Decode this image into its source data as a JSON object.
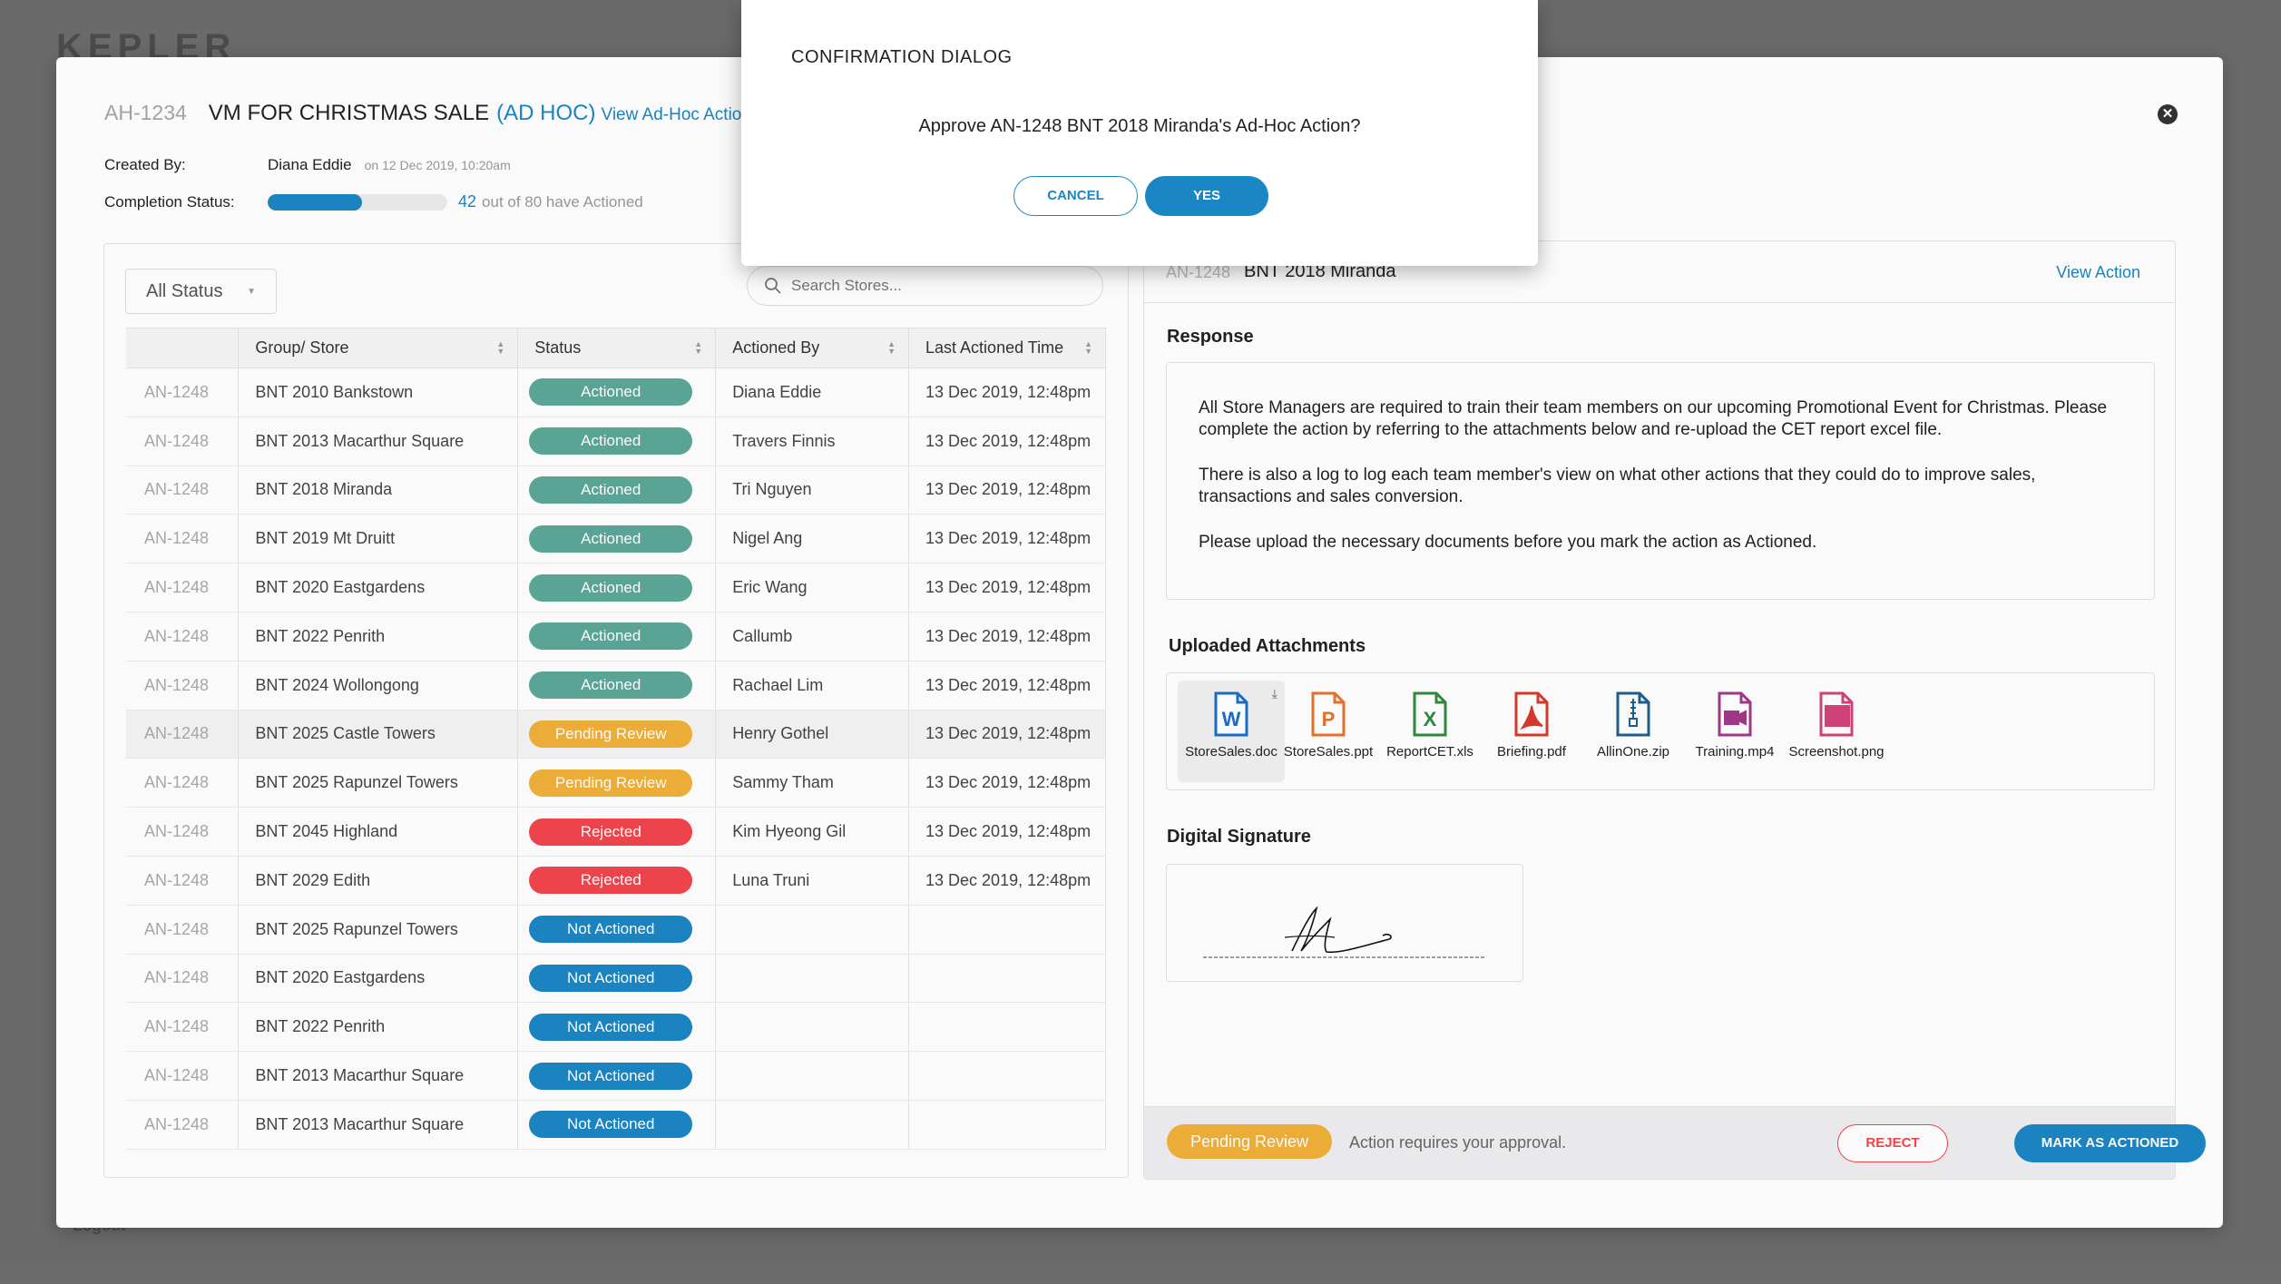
{
  "backdrop": {
    "logo": "KEPLER",
    "logout": "Logout"
  },
  "header": {
    "code": "AH-1234",
    "title": "VM FOR CHRISTMAS SALE",
    "tag": "(AD HOC)",
    "view_link": "View Ad-Hoc Action D"
  },
  "meta": {
    "created_by_label": "Created By:",
    "created_by": "Diana Eddie",
    "created_on": "on 12 Dec 2019, 10:20am",
    "completion_label": "Completion Status:",
    "completed_count": "42",
    "completed_rest": "out of 80 have Actioned",
    "progress_fraction": 0.525
  },
  "filter": {
    "value": "All Status"
  },
  "search": {
    "placeholder": "Search Stores..."
  },
  "table": {
    "headers": [
      "",
      "Group/ Store",
      "Status",
      "Actioned By",
      "Last Actioned Time"
    ],
    "rows": [
      {
        "code": "AN-1248",
        "store": "BNT 2010 Bankstown",
        "status": "Actioned",
        "kind": "actioned",
        "by": "Diana Eddie",
        "time": "13 Dec 2019, 12:48pm"
      },
      {
        "code": "AN-1248",
        "store": "BNT 2013 Macarthur Square",
        "status": "Actioned",
        "kind": "actioned",
        "by": "Travers Finnis",
        "time": "13 Dec 2019, 12:48pm"
      },
      {
        "code": "AN-1248",
        "store": "BNT 2018 Miranda",
        "status": "Actioned",
        "kind": "actioned",
        "by": "Tri Nguyen",
        "time": "13 Dec 2019, 12:48pm"
      },
      {
        "code": "AN-1248",
        "store": "BNT 2019 Mt Druitt",
        "status": "Actioned",
        "kind": "actioned",
        "by": "Nigel Ang",
        "time": "13 Dec 2019, 12:48pm"
      },
      {
        "code": "AN-1248",
        "store": "BNT 2020 Eastgardens",
        "status": "Actioned",
        "kind": "actioned",
        "by": "Eric Wang",
        "time": "13 Dec 2019, 12:48pm"
      },
      {
        "code": "AN-1248",
        "store": "BNT 2022 Penrith",
        "status": "Actioned",
        "kind": "actioned",
        "by": "Callumb",
        "time": "13 Dec 2019, 12:48pm"
      },
      {
        "code": "AN-1248",
        "store": "BNT 2024 Wollongong",
        "status": "Actioned",
        "kind": "actioned",
        "by": "Rachael Lim",
        "time": "13 Dec 2019, 12:48pm"
      },
      {
        "code": "AN-1248",
        "store": "BNT 2025 Castle Towers",
        "status": "Pending Review",
        "kind": "pending",
        "by": "Henry Gothel",
        "time": "13 Dec 2019, 12:48pm"
      },
      {
        "code": "AN-1248",
        "store": "BNT 2025 Rapunzel Towers",
        "status": "Pending Review",
        "kind": "pending",
        "by": "Sammy Tham",
        "time": "13 Dec 2019, 12:48pm"
      },
      {
        "code": "AN-1248",
        "store": "BNT 2045 Highland",
        "status": "Rejected",
        "kind": "rejected",
        "by": "Kim Hyeong Gil",
        "time": "13 Dec 2019, 12:48pm"
      },
      {
        "code": "AN-1248",
        "store": "BNT 2029 Edith",
        "status": "Rejected",
        "kind": "rejected",
        "by": "Luna Truni",
        "time": "13 Dec 2019, 12:48pm"
      },
      {
        "code": "AN-1248",
        "store": "BNT 2025 Rapunzel Towers",
        "status": "Not Actioned",
        "kind": "notact",
        "by": "",
        "time": ""
      },
      {
        "code": "AN-1248",
        "store": "BNT 2020 Eastgardens",
        "status": "Not Actioned",
        "kind": "notact",
        "by": "",
        "time": ""
      },
      {
        "code": "AN-1248",
        "store": "BNT 2022 Penrith",
        "status": "Not Actioned",
        "kind": "notact",
        "by": "",
        "time": ""
      },
      {
        "code": "AN-1248",
        "store": "BNT 2013 Macarthur Square",
        "status": "Not Actioned",
        "kind": "notact",
        "by": "",
        "time": ""
      },
      {
        "code": "AN-1248",
        "store": "BNT 2013 Macarthur Square",
        "status": "Not Actioned",
        "kind": "notact",
        "by": "",
        "time": ""
      }
    ]
  },
  "detail": {
    "code": "AN-1248",
    "name": "BNT 2018 Miranda",
    "view_action": "View Action",
    "response_title": "Response",
    "response": [
      "All Store Managers are required to train their team members on our upcoming Promotional Event for Christmas. Please complete the action by referring to the attachments below and re-upload the CET report excel file.",
      "There is also a log to log each team member's view on what other actions that they could do to improve sales, transactions and sales conversion.",
      "Please upload the necessary documents before you mark the action as Actioned."
    ],
    "attachments_title": "Uploaded Attachments",
    "attachments": [
      {
        "name": "StoreSales.doc",
        "letter": "W",
        "color": "#1b6fc4",
        "icon": "word-doc-icon"
      },
      {
        "name": "StoreSales.ppt",
        "letter": "P",
        "color": "#e8732a",
        "icon": "powerpoint-icon"
      },
      {
        "name": "ReportCET.xls",
        "letter": "X",
        "color": "#2f8a3f",
        "icon": "excel-icon"
      },
      {
        "name": "Briefing.pdf",
        "letter": "pdf",
        "color": "#d93a2b",
        "icon": "pdf-icon"
      },
      {
        "name": "AllinOne.zip",
        "letter": "zip",
        "color": "#1d5f8c",
        "icon": "zip-icon"
      },
      {
        "name": "Training.mp4",
        "letter": "mp4",
        "color": "#a13a8a",
        "icon": "video-icon"
      },
      {
        "name": "Screenshot.png",
        "letter": "img",
        "color": "#d2457a",
        "icon": "image-icon"
      }
    ],
    "signature_title": "Digital Signature",
    "footer_status": "Pending Review",
    "footer_note": "Action requires your approval.",
    "reject_label": "REJECT",
    "mark_label": "MARK AS ACTIONED"
  },
  "confirm": {
    "title": "CONFIRMATION DIALOG",
    "message": "Approve AN-1248 BNT 2018 Miranda's Ad-Hoc Action?",
    "cancel_label": "CANCEL",
    "yes_label": "YES"
  },
  "colors": {
    "accent": "#1b86c4",
    "actioned": "#5ba898",
    "pending": "#f0b03a",
    "rejected": "#f2454d"
  }
}
